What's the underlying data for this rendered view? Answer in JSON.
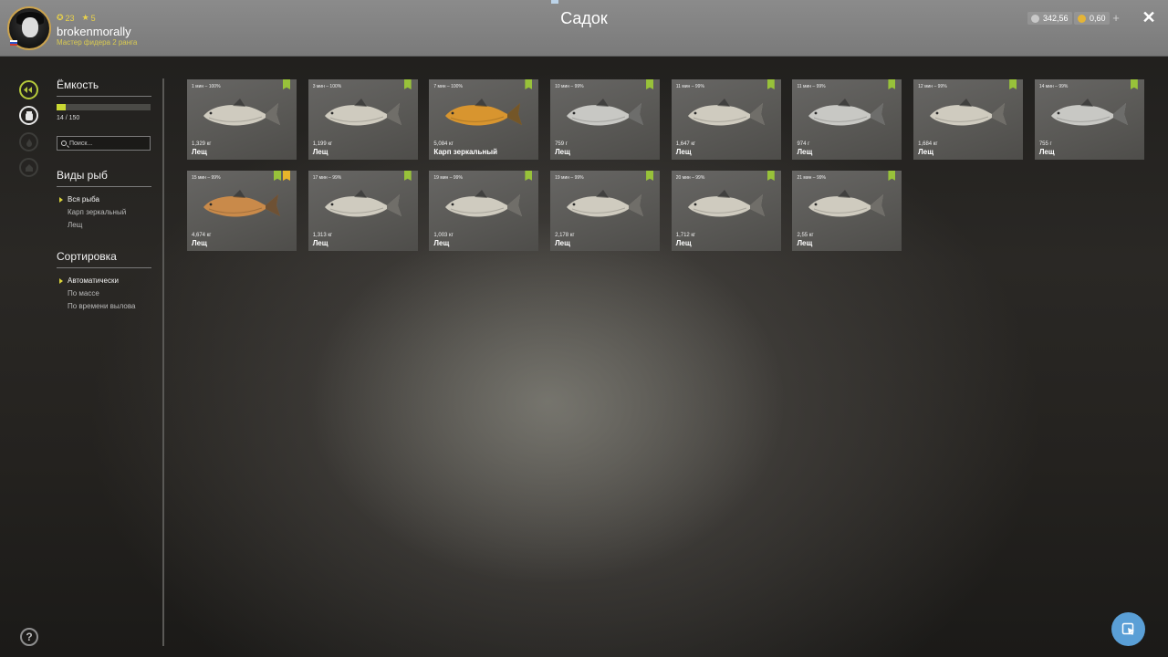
{
  "header": {
    "title": "Садок",
    "player": {
      "username": "brokenmorally",
      "rank_text": "Мастер фидера 2 ранга",
      "level": "23",
      "rank_level": "5"
    },
    "currency": [
      {
        "value": "342,56",
        "color": "#c8c8c8",
        "icon": "silver-coin-icon"
      },
      {
        "value": "0,60",
        "color": "#e4b437",
        "icon": "gold-coin-icon"
      }
    ],
    "plus_label": "+",
    "close_label": "✕"
  },
  "sidebar": {
    "capacity": {
      "heading": "Ёмкость",
      "label": "14 / 150",
      "fraction": 0.093
    },
    "search": {
      "placeholder": "Поиск..."
    },
    "species": {
      "heading": "Виды рыб",
      "items": [
        "Вся рыба",
        "Карп зеркальный",
        "Лещ"
      ],
      "selected": 0
    },
    "sort": {
      "heading": "Сортировка",
      "items": [
        "Автоматически",
        "По массе",
        "По времени вылова"
      ],
      "selected": 0
    },
    "help_label": "?"
  },
  "catches": [
    {
      "time": "1 мин – 100%",
      "weight": "1,329 кг",
      "name": "Лещ",
      "fish_color": "#cfcbbf",
      "badges": [
        "green"
      ]
    },
    {
      "time": "3 мин – 100%",
      "weight": "1,199 кг",
      "name": "Лещ",
      "fish_color": "#cfcbbf",
      "badges": [
        "green"
      ]
    },
    {
      "time": "7 мин – 100%",
      "weight": "5,084 кг",
      "name": "Карп зеркальный",
      "fish_color": "#d8952f",
      "badges": [
        "green"
      ]
    },
    {
      "time": "10 мин – 99%",
      "weight": "759 г",
      "name": "Лещ",
      "fish_color": "#c8c8c4",
      "badges": [
        "green"
      ]
    },
    {
      "time": "11 мин – 99%",
      "weight": "1,647 кг",
      "name": "Лещ",
      "fish_color": "#cfcbbf",
      "badges": [
        "green"
      ]
    },
    {
      "time": "11 мин – 99%",
      "weight": "974 г",
      "name": "Лещ",
      "fish_color": "#c8c8c4",
      "badges": [
        "green"
      ]
    },
    {
      "time": "12 мин – 99%",
      "weight": "1,684 кг",
      "name": "Лещ",
      "fish_color": "#cfcbbf",
      "badges": [
        "green"
      ]
    },
    {
      "time": "14 мин – 99%",
      "weight": "755 г",
      "name": "Лещ",
      "fish_color": "#c8c8c4",
      "badges": [
        "green"
      ]
    },
    {
      "time": "15 мин – 99%",
      "weight": "4,674 кг",
      "name": "Лещ",
      "fish_color": "#c98a4a",
      "badges": [
        "green",
        "gold"
      ]
    },
    {
      "time": "17 мин – 99%",
      "weight": "1,313 кг",
      "name": "Лещ",
      "fish_color": "#cfcbbf",
      "badges": [
        "green"
      ]
    },
    {
      "time": "19 мин – 99%",
      "weight": "1,003 кг",
      "name": "Лещ",
      "fish_color": "#cfcbbf",
      "badges": [
        "green"
      ]
    },
    {
      "time": "19 мин – 99%",
      "weight": "2,178 кг",
      "name": "Лещ",
      "fish_color": "#cfcbbf",
      "badges": [
        "green"
      ]
    },
    {
      "time": "20 мин – 99%",
      "weight": "1,712 кг",
      "name": "Лещ",
      "fish_color": "#cfcbbf",
      "badges": [
        "green"
      ]
    },
    {
      "time": "21 мин – 99%",
      "weight": "2,55 кг",
      "name": "Лещ",
      "fish_color": "#cfcbbf",
      "badges": [
        "green"
      ]
    }
  ]
}
